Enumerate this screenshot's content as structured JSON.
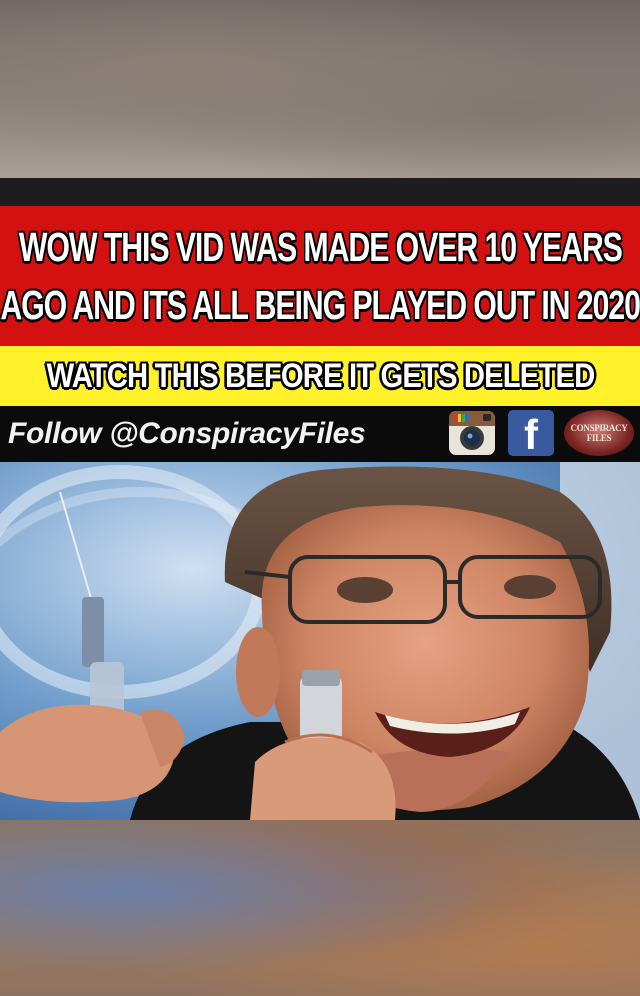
{
  "headline": {
    "line1": "WOW THIS VID WAS MADE OVER 10 YEARS",
    "line2": "AGO AND ITS ALL BEING PLAYED OUT IN 2020"
  },
  "subheadline": "WATCH THIS BEFORE IT GETS DELETED",
  "follow_bar": {
    "text": "Follow @ConspiracyFiles",
    "icons": [
      "instagram-icon",
      "facebook-icon",
      "conspiracy-files-logo"
    ],
    "facebook_glyph": "f",
    "logo_text": "CONSPIRACY FILES"
  },
  "colors": {
    "red_band": "#d41111",
    "yellow_band": "#fff22a",
    "black_band": "#0b0b0b",
    "facebook_blue": "#3a5a9f"
  }
}
